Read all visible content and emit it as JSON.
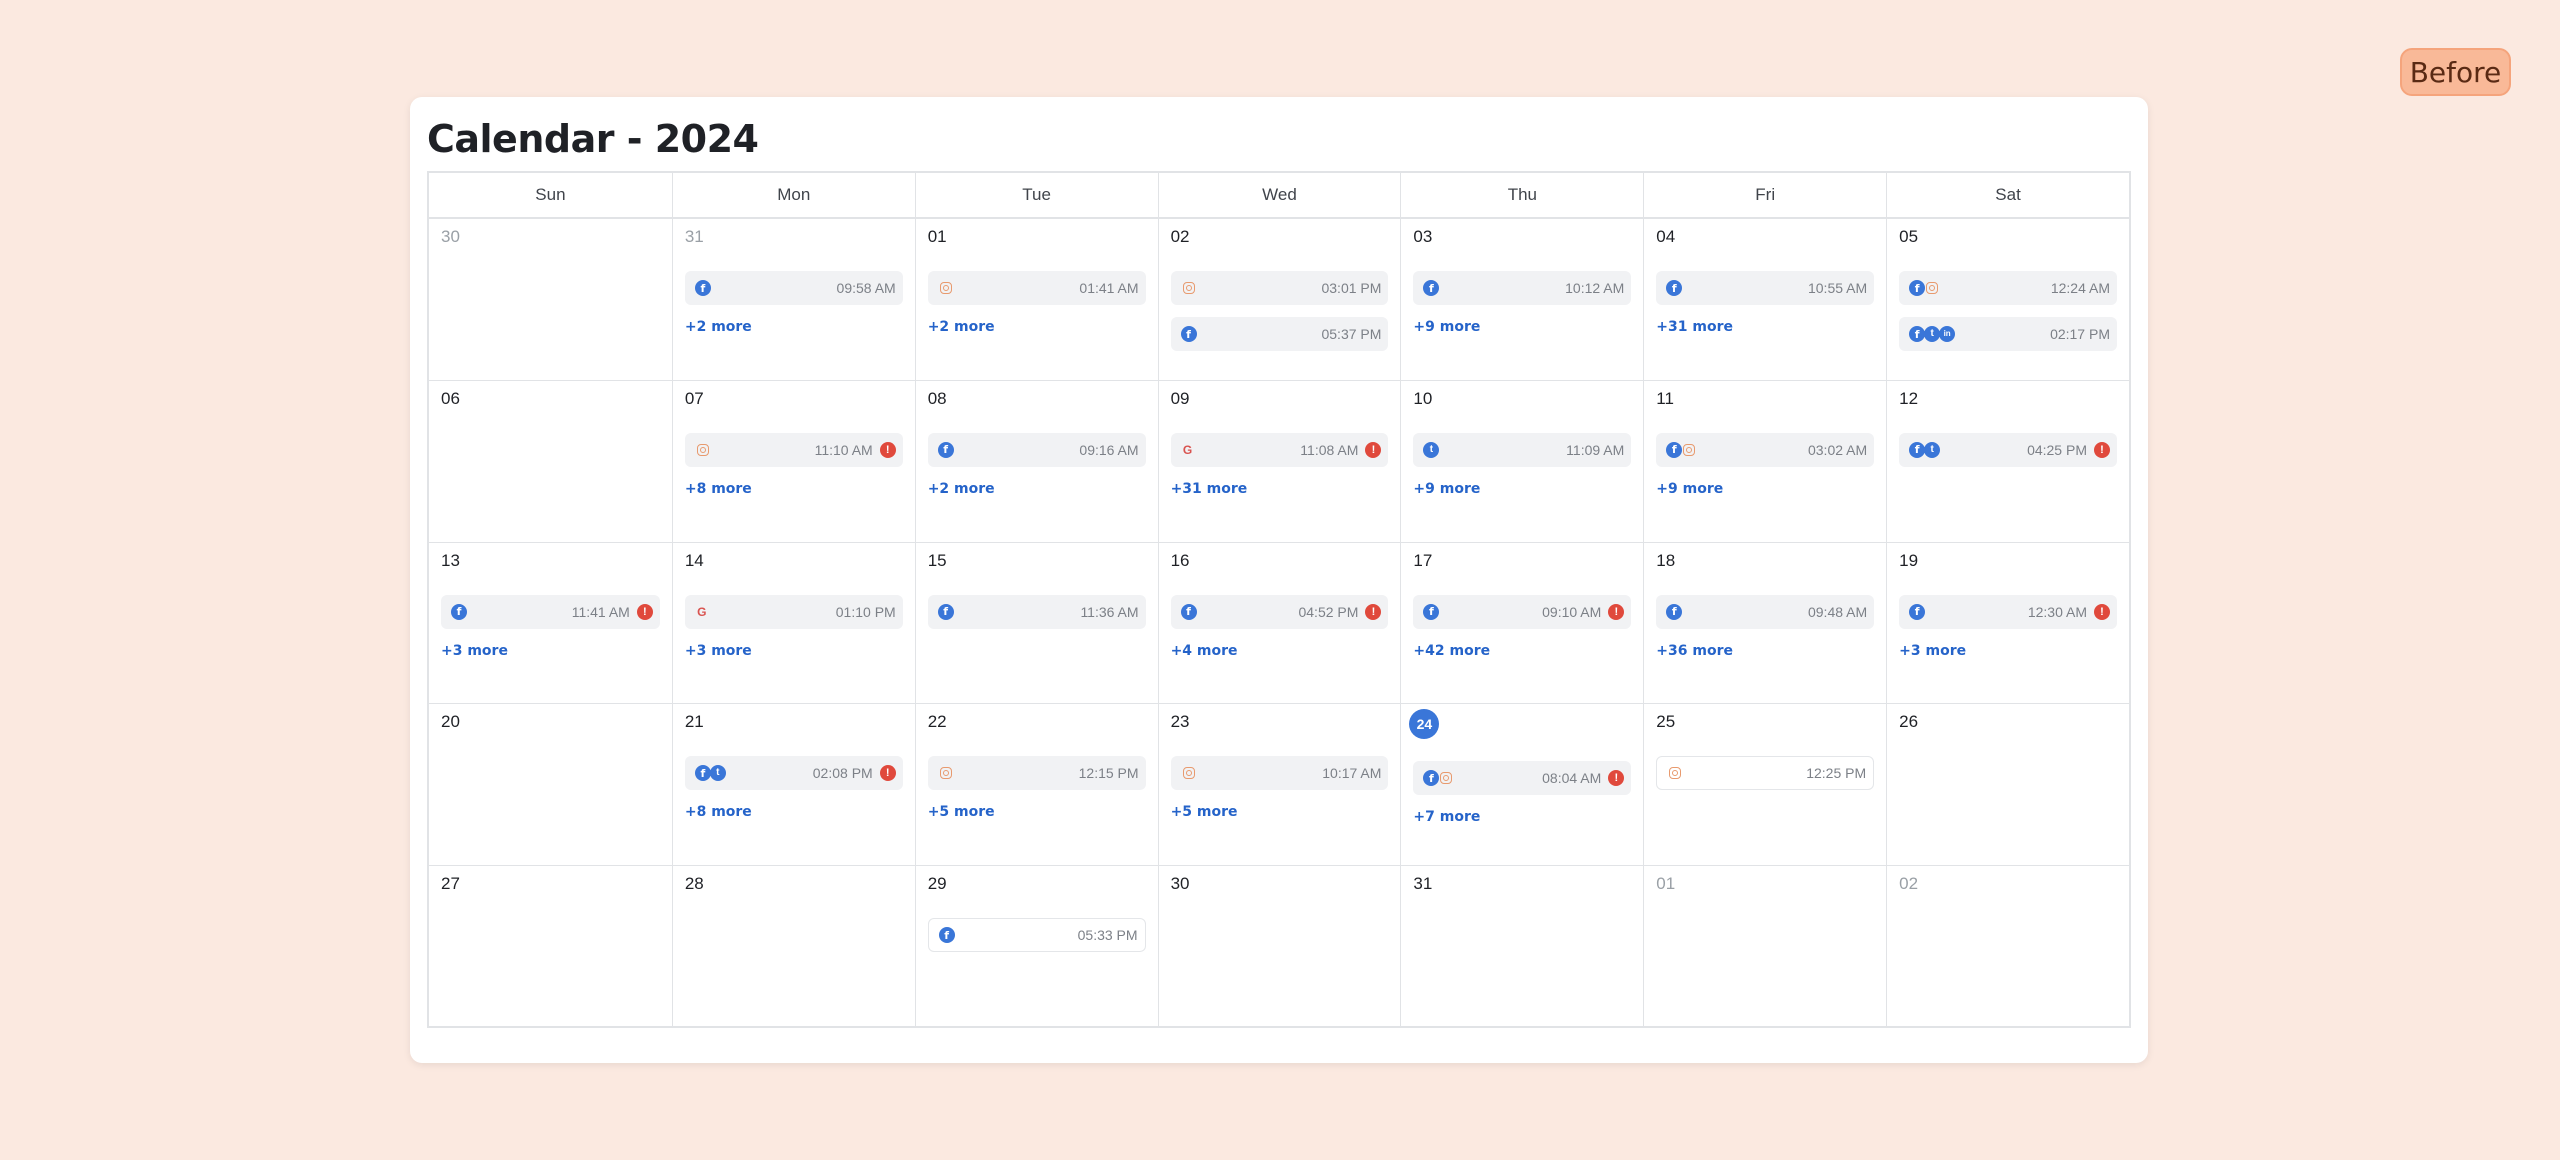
{
  "badge": "Before",
  "title": "Calendar - 2024",
  "weekdays": [
    "Sun",
    "Mon",
    "Tue",
    "Wed",
    "Thu",
    "Fri",
    "Sat"
  ],
  "weeks": [
    [
      {
        "day": "30",
        "muted": true,
        "posts": [],
        "more": ""
      },
      {
        "day": "31",
        "muted": true,
        "posts": [
          {
            "icons": [
              "facebook"
            ],
            "time": "09:58 AM"
          }
        ],
        "more": "+2 more"
      },
      {
        "day": "01",
        "posts": [
          {
            "icons": [
              "instagram"
            ],
            "time": "01:41 AM"
          }
        ],
        "more": "+2 more"
      },
      {
        "day": "02",
        "posts": [
          {
            "icons": [
              "instagram"
            ],
            "time": "03:01 PM"
          },
          {
            "icons": [
              "facebook"
            ],
            "time": "05:37 PM"
          }
        ],
        "more": ""
      },
      {
        "day": "03",
        "posts": [
          {
            "icons": [
              "facebook"
            ],
            "time": "10:12 AM"
          }
        ],
        "more": "+9 more"
      },
      {
        "day": "04",
        "posts": [
          {
            "icons": [
              "facebook"
            ],
            "time": "10:55 AM"
          }
        ],
        "more": "+31 more"
      },
      {
        "day": "05",
        "posts": [
          {
            "icons": [
              "facebook",
              "instagram"
            ],
            "time": "12:24 AM"
          },
          {
            "icons": [
              "facebook",
              "twitter",
              "linkedin"
            ],
            "time": "02:17 PM"
          }
        ],
        "more": ""
      }
    ],
    [
      {
        "day": "06",
        "posts": [],
        "more": ""
      },
      {
        "day": "07",
        "posts": [
          {
            "icons": [
              "instagram"
            ],
            "time": "11:10 AM",
            "alert": true
          }
        ],
        "more": "+8 more"
      },
      {
        "day": "08",
        "posts": [
          {
            "icons": [
              "facebook"
            ],
            "time": "09:16 AM"
          }
        ],
        "more": "+2 more"
      },
      {
        "day": "09",
        "posts": [
          {
            "icons": [
              "google"
            ],
            "time": "11:08 AM",
            "alert": true
          }
        ],
        "more": "+31 more"
      },
      {
        "day": "10",
        "posts": [
          {
            "icons": [
              "twitter"
            ],
            "time": "11:09 AM"
          }
        ],
        "more": "+9 more"
      },
      {
        "day": "11",
        "posts": [
          {
            "icons": [
              "facebook",
              "instagram"
            ],
            "time": "03:02 AM"
          }
        ],
        "more": "+9 more"
      },
      {
        "day": "12",
        "posts": [
          {
            "icons": [
              "facebook",
              "twitter"
            ],
            "time": "04:25 PM",
            "alert": true
          }
        ],
        "more": ""
      }
    ],
    [
      {
        "day": "13",
        "posts": [
          {
            "icons": [
              "facebook"
            ],
            "time": "11:41 AM",
            "alert": true
          }
        ],
        "more": "+3 more"
      },
      {
        "day": "14",
        "posts": [
          {
            "icons": [
              "google"
            ],
            "time": "01:10 PM"
          }
        ],
        "more": "+3 more"
      },
      {
        "day": "15",
        "posts": [
          {
            "icons": [
              "facebook"
            ],
            "time": "11:36 AM"
          }
        ],
        "more": ""
      },
      {
        "day": "16",
        "posts": [
          {
            "icons": [
              "facebook"
            ],
            "time": "04:52 PM",
            "alert": true
          }
        ],
        "more": "+4 more"
      },
      {
        "day": "17",
        "posts": [
          {
            "icons": [
              "facebook"
            ],
            "time": "09:10 AM",
            "alert": true
          }
        ],
        "more": "+42 more"
      },
      {
        "day": "18",
        "posts": [
          {
            "icons": [
              "facebook"
            ],
            "time": "09:48 AM"
          }
        ],
        "more": "+36 more"
      },
      {
        "day": "19",
        "posts": [
          {
            "icons": [
              "facebook"
            ],
            "time": "12:30 AM",
            "alert": true
          }
        ],
        "more": "+3 more"
      }
    ],
    [
      {
        "day": "20",
        "posts": [],
        "more": ""
      },
      {
        "day": "21",
        "posts": [
          {
            "icons": [
              "facebook",
              "twitter"
            ],
            "time": "02:08 PM",
            "alert": true
          }
        ],
        "more": "+8 more"
      },
      {
        "day": "22",
        "posts": [
          {
            "icons": [
              "instagram"
            ],
            "time": "12:15 PM"
          }
        ],
        "more": "+5 more"
      },
      {
        "day": "23",
        "posts": [
          {
            "icons": [
              "instagram"
            ],
            "time": "10:17 AM"
          }
        ],
        "more": "+5 more"
      },
      {
        "day": "24",
        "today": true,
        "posts": [
          {
            "icons": [
              "facebook",
              "instagram"
            ],
            "time": "08:04 AM",
            "alert": true
          }
        ],
        "more": "+7 more"
      },
      {
        "day": "25",
        "posts": [
          {
            "icons": [
              "instagram"
            ],
            "time": "12:25 PM",
            "white": true
          }
        ],
        "more": ""
      },
      {
        "day": "26",
        "posts": [],
        "more": ""
      }
    ],
    [
      {
        "day": "27",
        "posts": [],
        "more": ""
      },
      {
        "day": "28",
        "posts": [],
        "more": ""
      },
      {
        "day": "29",
        "posts": [
          {
            "icons": [
              "facebook"
            ],
            "time": "05:33 PM",
            "white": true
          }
        ],
        "more": ""
      },
      {
        "day": "30",
        "posts": [],
        "more": ""
      },
      {
        "day": "31",
        "posts": [],
        "more": ""
      },
      {
        "day": "01",
        "muted": true,
        "posts": [],
        "more": ""
      },
      {
        "day": "02",
        "muted": true,
        "posts": [],
        "more": ""
      }
    ]
  ],
  "icon_glyphs": {
    "facebook": "f",
    "twitter": "t",
    "linkedin": "in",
    "instagram": "",
    "google": "G"
  },
  "alert_glyph": "!",
  "colors": {
    "accent": "#3a76d8",
    "alert": "#e0493c",
    "link": "#2563c9",
    "background": "#fbe9e0"
  }
}
